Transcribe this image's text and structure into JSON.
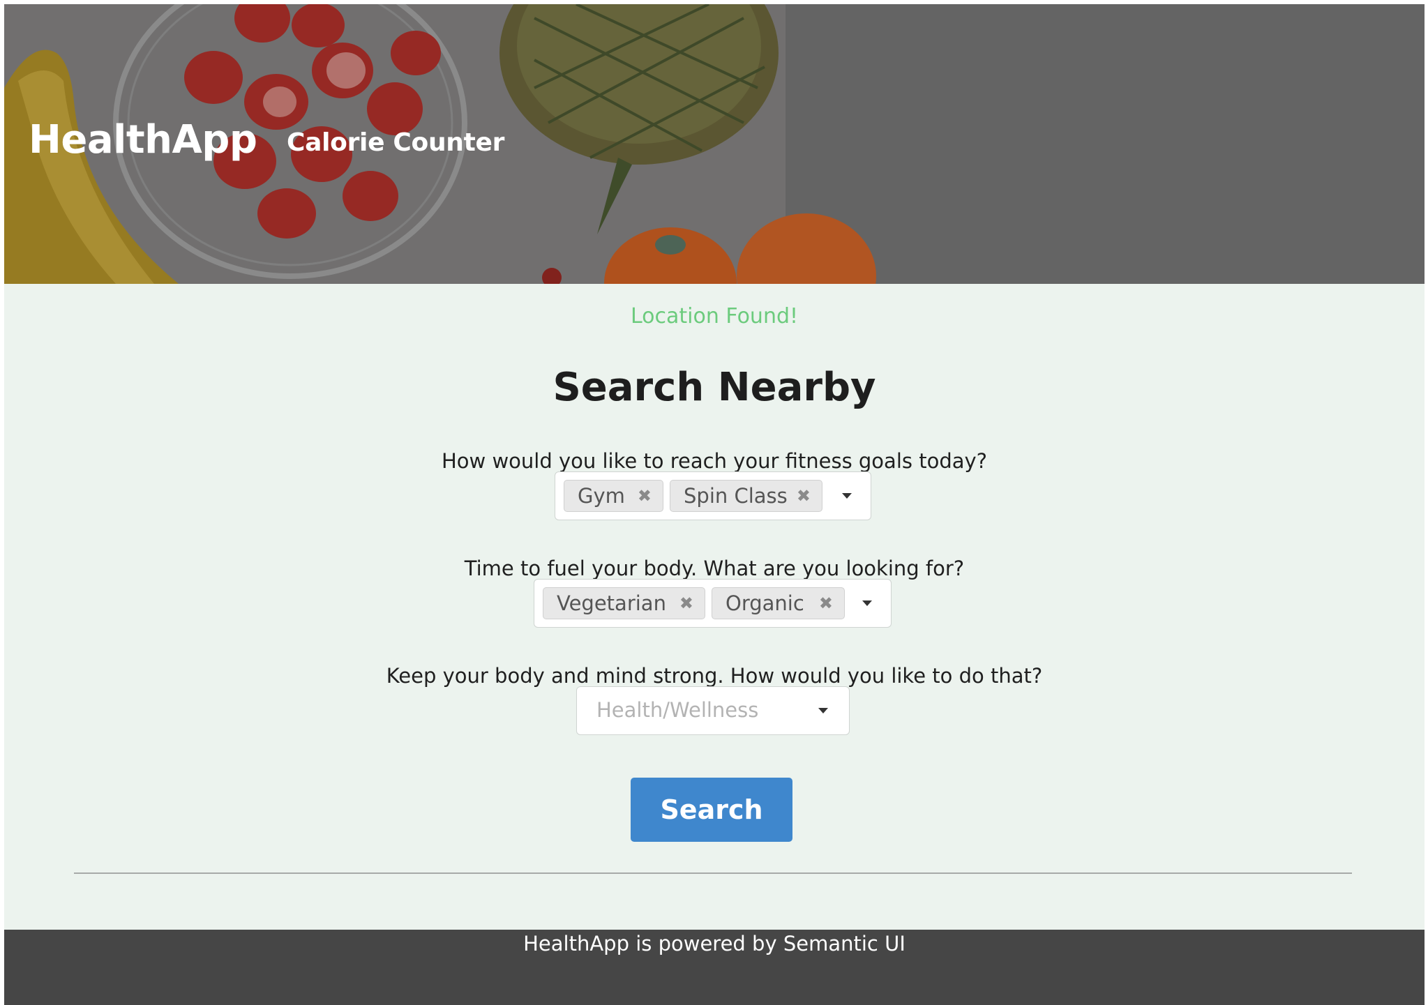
{
  "header": {
    "brand": "HealthApp",
    "nav_link": "Calorie Counter"
  },
  "status_message": "Location Found!",
  "page_title": "Search Nearby",
  "fitness": {
    "question": "How would you like to reach your fitness goals today?",
    "selected": [
      "Gym",
      "Spin Class"
    ]
  },
  "food": {
    "question": "Time to fuel your body. What are you looking for?",
    "selected": [
      "Vegetarian",
      "Organic"
    ]
  },
  "wellness": {
    "question": "Keep your body and mind strong. How would you like to do that?",
    "placeholder": "Health/Wellness"
  },
  "search_button": "Search",
  "footer_text": "HealthApp is powered by Semantic UI",
  "icons": {
    "remove": "close-icon",
    "dropdown": "caret-down-icon"
  },
  "colors": {
    "status": "#6ccb7d",
    "primary_button": "#3f87cd",
    "page_background": "#ecf3ee",
    "footer": "#464646"
  }
}
